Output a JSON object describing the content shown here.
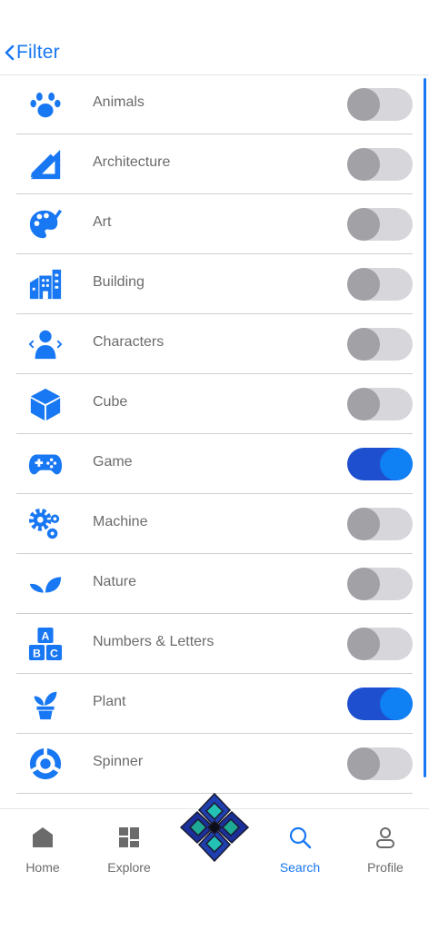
{
  "header": {
    "back_label": "Filter"
  },
  "accent": "#1877f2",
  "filters": [
    {
      "label": "Animals",
      "icon": "paw-icon",
      "on": false
    },
    {
      "label": "Architecture",
      "icon": "ruler-pencil-icon",
      "on": false
    },
    {
      "label": "Art",
      "icon": "palette-icon",
      "on": false
    },
    {
      "label": "Building",
      "icon": "building-icon",
      "on": false
    },
    {
      "label": "Characters",
      "icon": "person-icon",
      "on": false
    },
    {
      "label": "Cube",
      "icon": "cube-icon",
      "on": false
    },
    {
      "label": "Game",
      "icon": "gamepad-icon",
      "on": true
    },
    {
      "label": "Machine",
      "icon": "gears-icon",
      "on": false
    },
    {
      "label": "Nature",
      "icon": "leaves-icon",
      "on": false
    },
    {
      "label": "Numbers & Letters",
      "icon": "abc-blocks-icon",
      "on": false
    },
    {
      "label": "Plant",
      "icon": "potted-plant-icon",
      "on": true
    },
    {
      "label": "Spinner",
      "icon": "spinner-icon",
      "on": false
    }
  ],
  "tabs": [
    {
      "label": "Home",
      "icon": "home-icon",
      "active": false
    },
    {
      "label": "Explore",
      "icon": "grid-icon",
      "active": false
    },
    {
      "label": "Search",
      "icon": "search-icon",
      "active": true
    },
    {
      "label": "Profile",
      "icon": "profile-icon",
      "active": false
    }
  ]
}
